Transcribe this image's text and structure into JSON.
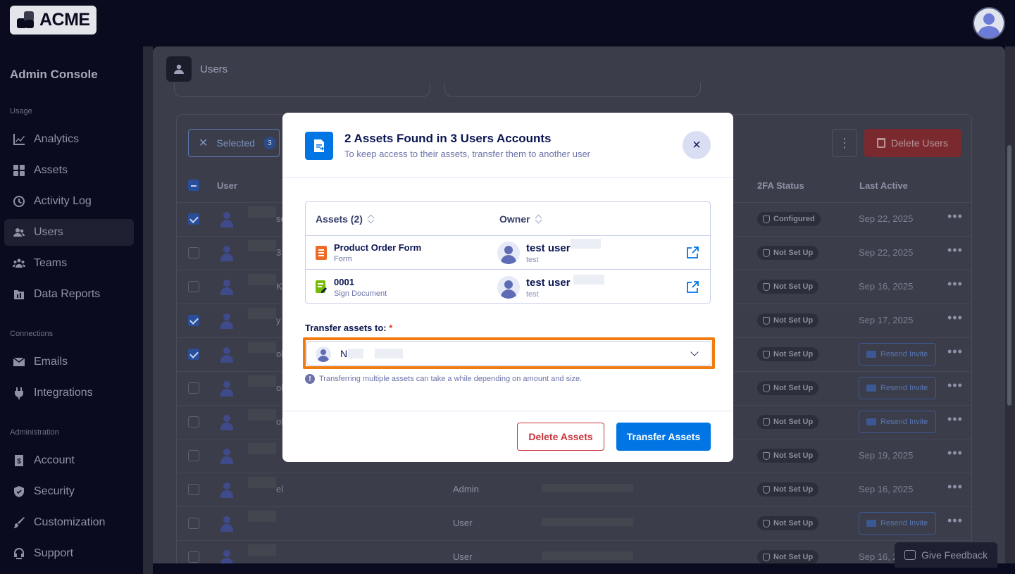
{
  "app": {
    "logo_text": "ACME"
  },
  "sidebar": {
    "title": "Admin Console",
    "sections": [
      {
        "label": "Usage"
      },
      {
        "label": "Connections"
      },
      {
        "label": "Administration"
      }
    ],
    "items": [
      {
        "label": "Analytics",
        "icon": "chart-icon"
      },
      {
        "label": "Assets",
        "icon": "grid-icon"
      },
      {
        "label": "Activity Log",
        "icon": "clock-icon"
      },
      {
        "label": "Users",
        "icon": "users-icon",
        "active": true
      },
      {
        "label": "Teams",
        "icon": "team-icon"
      },
      {
        "label": "Data Reports",
        "icon": "report-icon"
      },
      {
        "label": "Emails",
        "icon": "envelope-icon"
      },
      {
        "label": "Integrations",
        "icon": "plug-icon"
      },
      {
        "label": "Account",
        "icon": "account-icon"
      },
      {
        "label": "Security",
        "icon": "shield-icon"
      },
      {
        "label": "Customization",
        "icon": "brush-icon"
      },
      {
        "label": "Support",
        "icon": "support-icon"
      }
    ]
  },
  "page": {
    "title": "Users"
  },
  "toolbar": {
    "selected_label": "Selected",
    "selected_count": "3",
    "kebab": "⋮",
    "delete_users_label": "Delete Users"
  },
  "table": {
    "headers": {
      "user": "User",
      "tfa": "2FA Status",
      "last_active": "Last Active"
    },
    "rows": [
      {
        "checked": true,
        "text": "se",
        "role": "",
        "tfa": "Configured",
        "last_active": "Sep 22, 2025"
      },
      {
        "checked": false,
        "text": "3",
        "role": "",
        "tfa": "Not Set Up",
        "last_active": "Sep 22, 2025"
      },
      {
        "checked": false,
        "text": "K",
        "role": "",
        "tfa": "Not Set Up",
        "last_active": "Sep 16, 2025"
      },
      {
        "checked": true,
        "text": "y",
        "role": "",
        "tfa": "Not Set Up",
        "last_active": "Sep 17, 2025"
      },
      {
        "checked": true,
        "text": "ol",
        "role": "",
        "tfa": "Not Set Up",
        "last_active": "Resend Invite"
      },
      {
        "checked": false,
        "text": "ol",
        "role": "",
        "tfa": "Not Set Up",
        "last_active": "Resend Invite"
      },
      {
        "checked": false,
        "text": "ol",
        "role": "",
        "tfa": "Not Set Up",
        "last_active": "Resend Invite"
      },
      {
        "checked": false,
        "text": "",
        "role": "",
        "tfa": "Not Set Up",
        "last_active": "Sep 19, 2025"
      },
      {
        "checked": false,
        "text": "el",
        "role": "Admin",
        "tfa": "Not Set Up",
        "last_active": "Sep 16, 2025"
      },
      {
        "checked": false,
        "text": "",
        "role": "User",
        "tfa": "Not Set Up",
        "last_active": "Resend Invite"
      },
      {
        "checked": false,
        "text": "",
        "role": "User",
        "tfa": "Not Set Up",
        "last_active": "Sep 16, 2"
      }
    ]
  },
  "feedback": {
    "label": "Give Feedback"
  },
  "modal": {
    "title": "2 Assets Found in 3 Users Accounts",
    "subtitle": "To keep access to their assets, transfer them to another user",
    "close": "×",
    "assets_header": "Assets (2)",
    "owner_header": "Owner",
    "assets": [
      {
        "name": "Product Order Form",
        "type": "Form",
        "owner": "test user",
        "owner_sub": "test",
        "icon": "form-icon"
      },
      {
        "name": "0001",
        "type": "Sign Document",
        "owner": "test user",
        "owner_sub": "test",
        "icon": "sign-document-icon"
      }
    ],
    "transfer_label": "Transfer assets to:",
    "required_mark": "*",
    "selected_user": "N      G",
    "hint_icon": "!",
    "hint": "Transferring multiple assets can take a while depending on amount and size.",
    "delete_label": "Delete Assets",
    "transfer_button": "Transfer Assets"
  },
  "colors": {
    "primary": "#0075e3",
    "danger": "#c9343b",
    "highlight": "#f07c10",
    "navy": "#0a1551"
  }
}
